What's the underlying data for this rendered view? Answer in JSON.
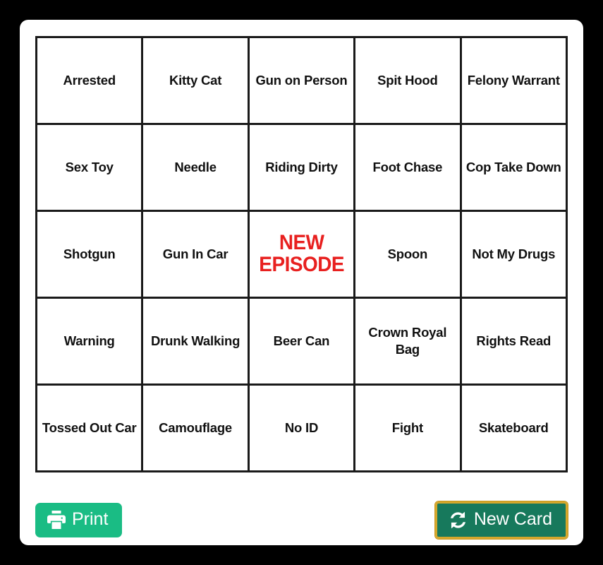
{
  "page": {
    "background_color": "#000000",
    "card_background": "#ffffff"
  },
  "card": {
    "grid": {
      "rows": [
        [
          {
            "label": "Arrested",
            "free": false
          },
          {
            "label": "Kitty Cat",
            "free": false
          },
          {
            "label": "Gun on Person",
            "free": false
          },
          {
            "label": "Spit Hood",
            "free": false
          },
          {
            "label": "Felony Warrant",
            "free": false
          }
        ],
        [
          {
            "label": "Sex Toy",
            "free": false
          },
          {
            "label": "Needle",
            "free": false
          },
          {
            "label": "Riding Dirty",
            "free": false
          },
          {
            "label": "Foot Chase",
            "free": false
          },
          {
            "label": "Cop Take Down",
            "free": false
          }
        ],
        [
          {
            "label": "Shotgun",
            "free": false
          },
          {
            "label": "Gun In Car",
            "free": false
          },
          {
            "label": "NEW EPISODE",
            "free": true
          },
          {
            "label": "Spoon",
            "free": false
          },
          {
            "label": "Not My Drugs",
            "free": false
          }
        ],
        [
          {
            "label": "Warning",
            "free": false
          },
          {
            "label": "Drunk Walking",
            "free": false
          },
          {
            "label": "Beer Can",
            "free": false
          },
          {
            "label": "Crown Royal Bag",
            "free": false
          },
          {
            "label": "Rights Read",
            "free": false
          }
        ],
        [
          {
            "label": "Tossed Out Car",
            "free": false
          },
          {
            "label": "Camouflage",
            "free": false
          },
          {
            "label": "No ID",
            "free": false
          },
          {
            "label": "Fight",
            "free": false
          },
          {
            "label": "Skateboard",
            "free": false
          }
        ]
      ],
      "free_space_color": "#e8201f",
      "cell_text_color": "#111111",
      "border_color": "#1a1a1a"
    },
    "buttons": {
      "print": {
        "label": "Print",
        "icon": "print-icon",
        "background_color": "#1abc84",
        "text_color": "#ffffff"
      },
      "new_card": {
        "label": "New Card",
        "icon": "sync-icon",
        "background_color": "#17795c",
        "text_color": "#ffffff",
        "focus_ring_color": "#d4a72c"
      }
    }
  }
}
